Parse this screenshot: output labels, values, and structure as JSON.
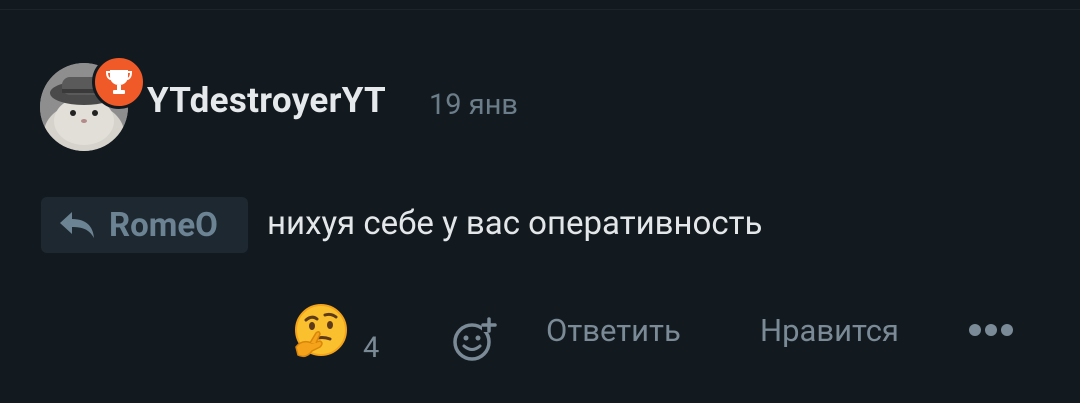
{
  "comment": {
    "author": "YTdestroyerYT",
    "date": "19 янв",
    "reply_to": "RomeO",
    "text": "нихуя себе у вас оперативность"
  },
  "actions": {
    "reaction_emoji": "thinking-face-icon",
    "reaction_count": "4",
    "reply_label": "Ответить",
    "like_label": "Нравится"
  },
  "colors": {
    "background": "#131a1f",
    "badge": "#f05a28",
    "muted": "#7a8a96",
    "text": "#e3e7ea"
  }
}
